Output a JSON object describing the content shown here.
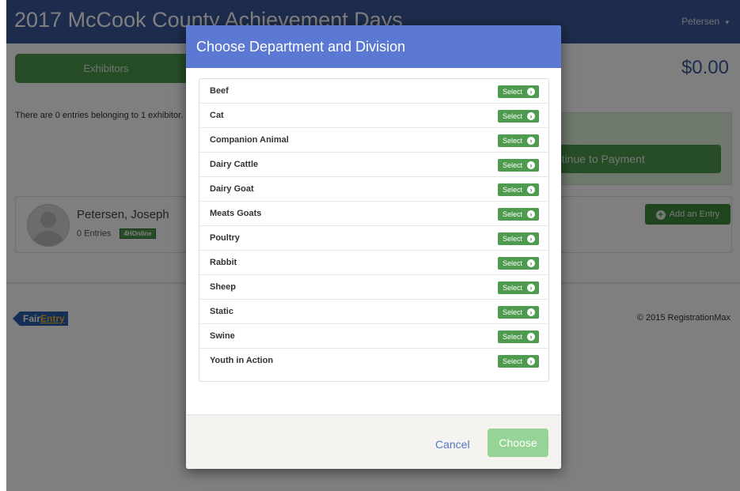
{
  "app": {
    "title": "2017 McCook County Achievement Days",
    "user_menu": "Petersen",
    "caret": "▾"
  },
  "toolbar": {
    "exhibitors_label": "Exhibitors",
    "cart_total": "$0.00"
  },
  "summary": {
    "entries_text": "There are 0 entries belonging to 1 exhibitor."
  },
  "payment": {
    "continue_label": "Continue to Payment"
  },
  "exhibitor": {
    "name": "Petersen, Joseph",
    "entries": "0 Entries",
    "badge": "4HOnline",
    "add_entry_label": "Add an Entry"
  },
  "footer": {
    "logo_part1": "Fair",
    "logo_part2": "Entry",
    "copyright": "© 2015 RegistrationMax"
  },
  "modal": {
    "title": "Choose Department and Division",
    "select_label": "Select",
    "departments": [
      {
        "name": "Beef"
      },
      {
        "name": "Cat"
      },
      {
        "name": "Companion Animal"
      },
      {
        "name": "Dairy Cattle"
      },
      {
        "name": "Dairy Goat"
      },
      {
        "name": "Meats Goats"
      },
      {
        "name": "Poultry"
      },
      {
        "name": "Rabbit"
      },
      {
        "name": "Sheep"
      },
      {
        "name": "Static"
      },
      {
        "name": "Swine"
      },
      {
        "name": "Youth in Action"
      }
    ],
    "cancel_label": "Cancel",
    "choose_label": "Choose"
  },
  "colors": {
    "navbar": "#3b5998",
    "modal_header": "#5b79d3",
    "primary_green": "#4e9a4e",
    "choose_disabled": "#96d396"
  },
  "icons": {
    "select": "circle-arrow-right-icon",
    "add": "plus-circle-icon",
    "user": "caret-down-icon"
  }
}
